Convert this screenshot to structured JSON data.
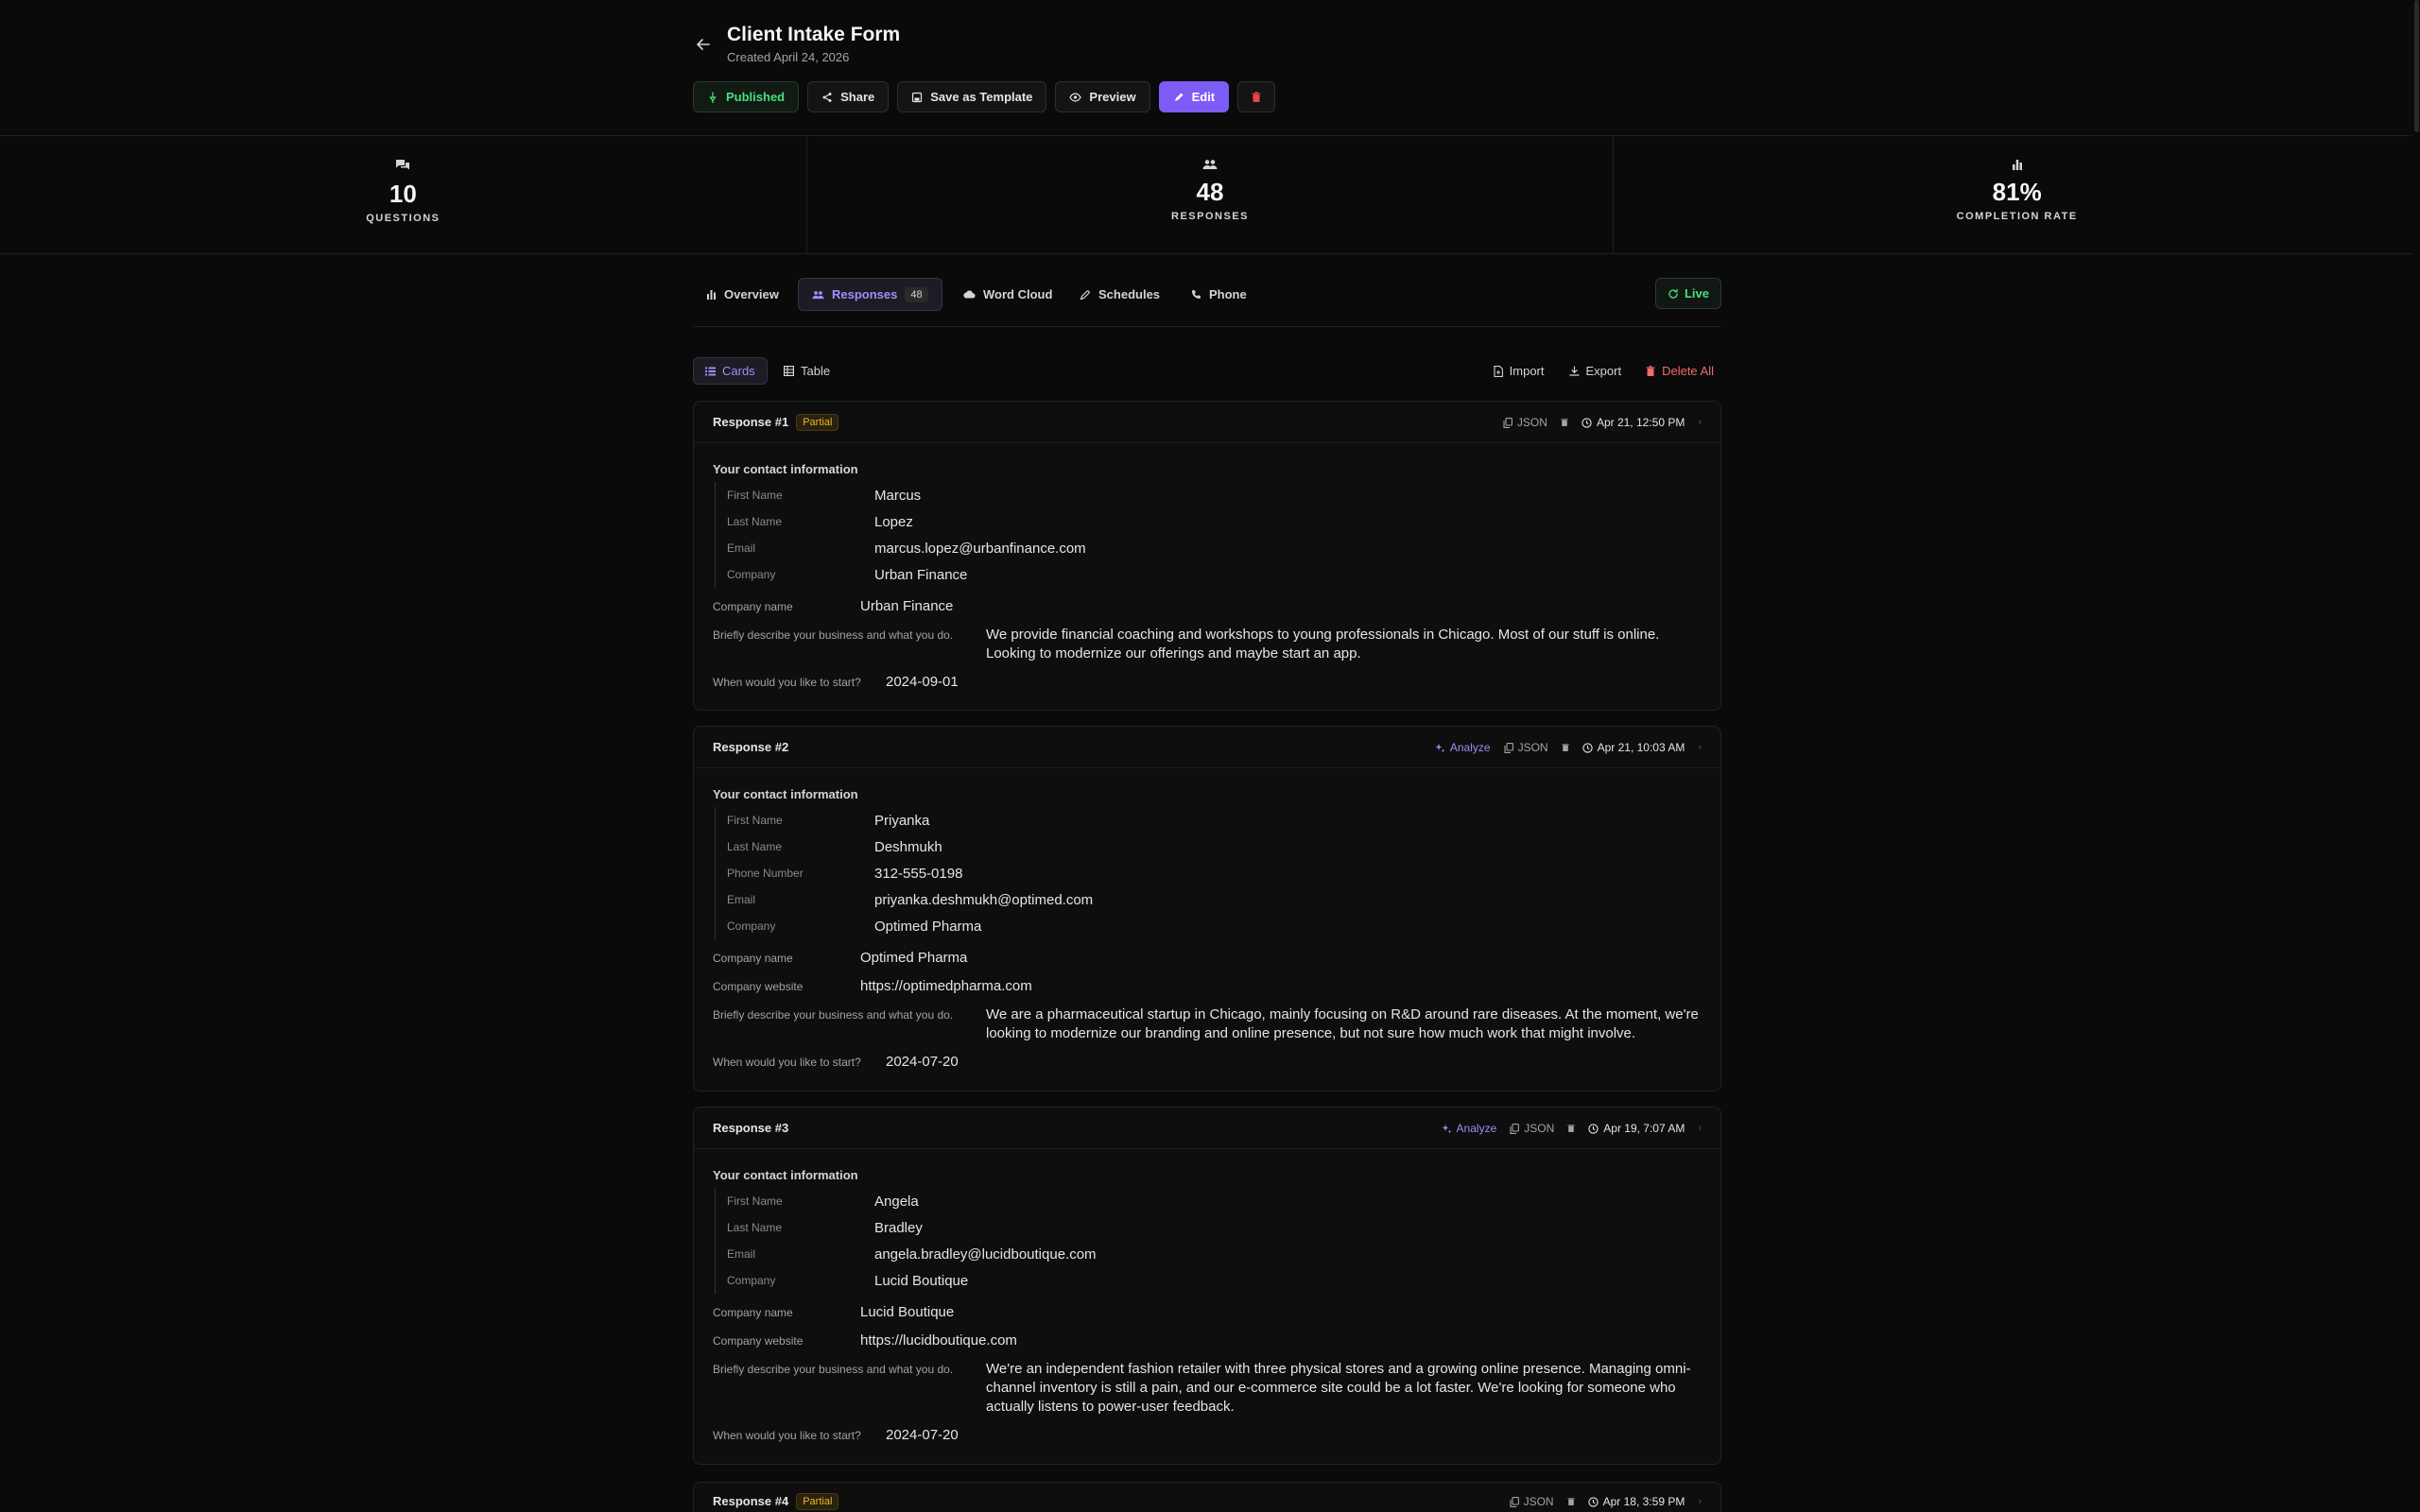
{
  "form": {
    "title": "Client Intake Form",
    "created": "Created April 24, 2026"
  },
  "toolbar": {
    "published": "Published",
    "share": "Share",
    "save_template": "Save as Template",
    "preview": "Preview",
    "edit": "Edit"
  },
  "stats": [
    {
      "value": "10",
      "label": "QUESTIONS",
      "icon": "question-icon"
    },
    {
      "value": "48",
      "label": "RESPONSES",
      "icon": "users-icon"
    },
    {
      "value": "81%",
      "label": "COMPLETION RATE",
      "icon": "bar-chart-icon"
    }
  ],
  "tabs": {
    "overview": "Overview",
    "responses": "Responses",
    "responses_count": "48",
    "word_cloud": "Word Cloud",
    "schedules": "Schedules",
    "phone": "Phone",
    "live": "Live"
  },
  "view": {
    "cards": "Cards",
    "table": "Table",
    "import": "Import",
    "export": "Export",
    "delete_all": "Delete All"
  },
  "labels": {
    "contact_section": "Your contact information",
    "company_name": "Company name",
    "company_website": "Company website",
    "describe": "Briefly describe your business and what you do.",
    "start": "When would you like to start?",
    "analyze": "Analyze",
    "json": "JSON",
    "partial": "Partial"
  },
  "responses": [
    {
      "title": "Response #1",
      "partial": true,
      "date": "Apr 21, 12:50 PM",
      "contact": [
        {
          "label": "First Name",
          "value": "Marcus"
        },
        {
          "label": "Last Name",
          "value": "Lopez"
        },
        {
          "label": "Email",
          "value": "marcus.lopez@urbanfinance.com"
        },
        {
          "label": "Company",
          "value": "Urban Finance"
        }
      ],
      "company_name": "Urban Finance",
      "describe": "We provide financial coaching and workshops to young professionals in Chicago. Most of our stuff is online. Looking to modernize our offerings and maybe start an app.",
      "start": "2024-09-01"
    },
    {
      "title": "Response #2",
      "partial": false,
      "date": "Apr 21, 10:03 AM",
      "contact": [
        {
          "label": "First Name",
          "value": "Priyanka"
        },
        {
          "label": "Last Name",
          "value": "Deshmukh"
        },
        {
          "label": "Phone Number",
          "value": "312-555-0198"
        },
        {
          "label": "Email",
          "value": "priyanka.deshmukh@optimed.com"
        },
        {
          "label": "Company",
          "value": "Optimed Pharma"
        }
      ],
      "company_name": "Optimed Pharma",
      "company_website": "https://optimedpharma.com",
      "describe": "We are a pharmaceutical startup in Chicago, mainly focusing on R&D around rare diseases. At the moment, we're looking to modernize our branding and online presence, but not sure how much work that might involve.",
      "start": "2024-07-20"
    },
    {
      "title": "Response #3",
      "partial": false,
      "date": "Apr 19, 7:07 AM",
      "contact": [
        {
          "label": "First Name",
          "value": "Angela"
        },
        {
          "label": "Last Name",
          "value": "Bradley"
        },
        {
          "label": "Email",
          "value": "angela.bradley@lucidboutique.com"
        },
        {
          "label": "Company",
          "value": "Lucid Boutique"
        }
      ],
      "company_name": "Lucid Boutique",
      "company_website": "https://lucidboutique.com",
      "describe": "We're an independent fashion retailer with three physical stores and a growing online presence. Managing omni-channel inventory is still a pain, and our e-commerce site could be a lot faster. We're looking for someone who actually listens to power-user feedback.",
      "start": "2024-07-20"
    },
    {
      "title": "Response #4",
      "partial": true,
      "date": "Apr 18, 3:59 PM"
    }
  ],
  "colors": {
    "accent": "#7c5cf4",
    "accent_text": "#a78bfa",
    "success": "#4ade80",
    "warning": "#f0b429",
    "danger": "#ef4444"
  }
}
